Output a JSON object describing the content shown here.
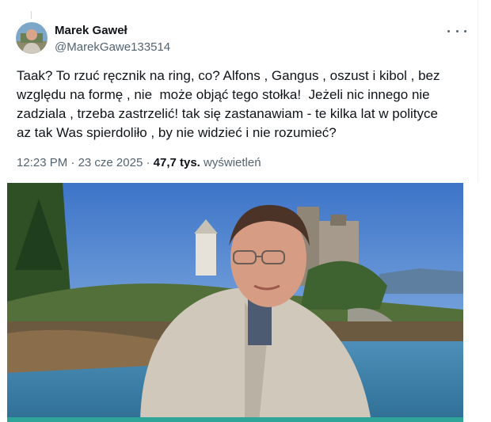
{
  "tweet": {
    "author_name": "Marek Gaweł",
    "author_handle": "@MarekGawe133514",
    "text": "Taak? To rzuć ręcznik na ring, co? Alfons , Gangus , oszust i kibol , bez\nwzględu na formę , nie  może objąć tego stołka!  Jeżeli nic innego nie\nzadziala , trzeba zastrzelić! tak się zastanawiam - te kilka lat w polityce\naz tak Was spierdoliło , by nie widzieć i nie rozumieć?",
    "time": "12:23 PM",
    "separator": "·",
    "date": "23 cze 2025",
    "views_count": "47,7 tys.",
    "views_label": "wyświetleń"
  },
  "icons": {
    "more": "more-horizontal-icon"
  }
}
